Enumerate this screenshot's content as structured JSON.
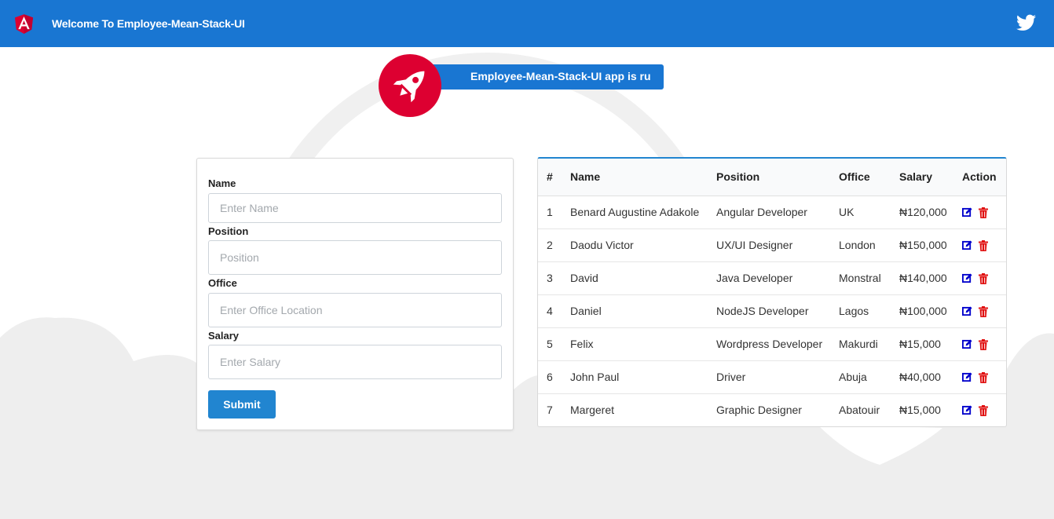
{
  "header": {
    "title": "Welcome To Employee-Mean-Stack-UI",
    "logo_icon": "angular-logo-icon",
    "social_icon": "twitter-icon",
    "color": "#1976d2"
  },
  "banner": {
    "text": "Employee-Mean-Stack-UI app is running!",
    "icon": "rocket-icon"
  },
  "form": {
    "name_label": "Name",
    "name_placeholder": "Enter Name",
    "position_label": "Position",
    "position_placeholder": "Position",
    "office_label": "Office",
    "office_placeholder": "Enter Office Location",
    "salary_label": "Salary",
    "salary_placeholder": "Enter Salary",
    "submit_label": "Submit"
  },
  "table": {
    "columns": [
      "#",
      "Name",
      "Position",
      "Office",
      "Salary",
      "Action"
    ],
    "rows": [
      {
        "index": "1",
        "name": "Benard Augustine Adakole",
        "position": "Angular Developer",
        "office": "UK",
        "salary": "₦120,000"
      },
      {
        "index": "2",
        "name": "Daodu Victor",
        "position": "UX/UI Designer",
        "office": "London",
        "salary": "₦150,000"
      },
      {
        "index": "3",
        "name": "David",
        "position": "Java Developer",
        "office": "Monstral",
        "salary": "₦140,000"
      },
      {
        "index": "4",
        "name": "Daniel",
        "position": "NodeJS Developer",
        "office": "Lagos",
        "salary": "₦100,000"
      },
      {
        "index": "5",
        "name": "Felix",
        "position": "Wordpress Developer",
        "office": "Makurdi",
        "salary": "₦15,000"
      },
      {
        "index": "6",
        "name": "John Paul",
        "position": "Driver",
        "office": "Abuja",
        "salary": "₦40,000"
      },
      {
        "index": "7",
        "name": "Margeret",
        "position": "Graphic Designer",
        "office": "Abatouir",
        "salary": "₦15,000"
      }
    ],
    "edit_icon": "edit-icon",
    "delete_icon": "trash-icon",
    "colors": {
      "edit": "#0000cc",
      "delete": "#e01010",
      "accent": "#2185d0"
    }
  }
}
